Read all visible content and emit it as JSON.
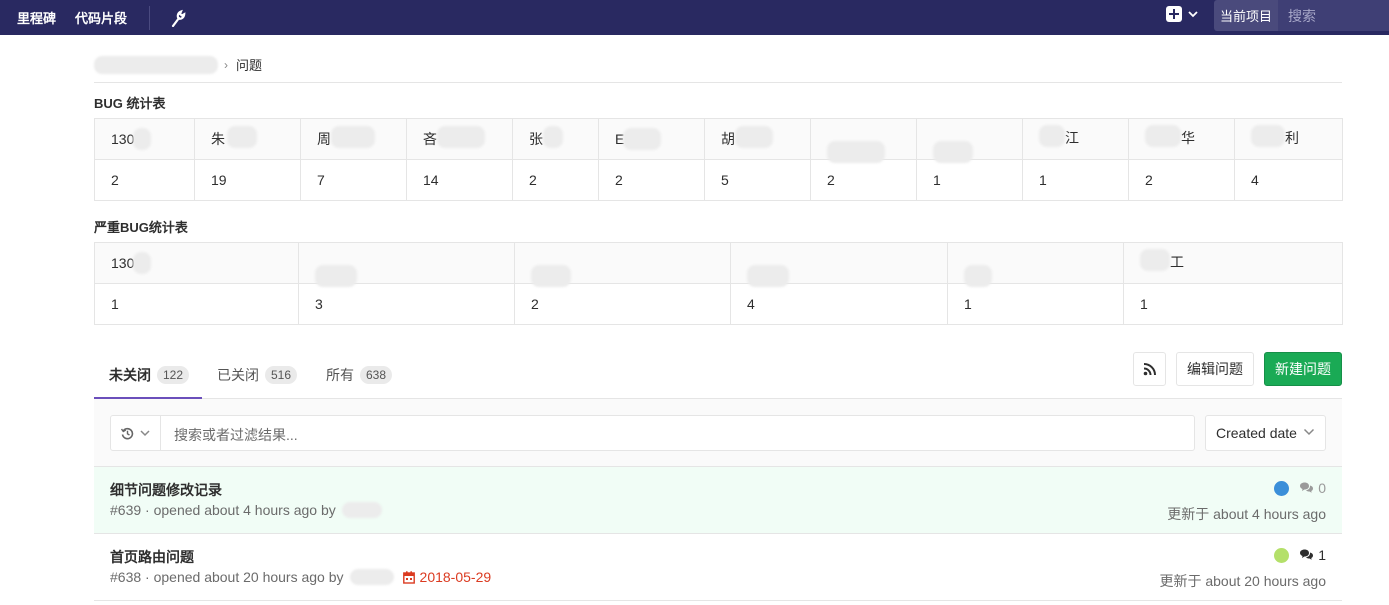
{
  "nav": {
    "links": [
      "里程碑",
      "代码片段"
    ],
    "scope_label": "当前项目",
    "search_placeholder": "搜索",
    "icons": [
      "wrench-icon",
      "plus-square-icon",
      "chevron-down-icon"
    ]
  },
  "breadcrumb": {
    "current": "问题"
  },
  "bug_table": {
    "title": "BUG 统计表",
    "names": [
      "130",
      "朱",
      "周",
      "吝",
      "张",
      "E",
      "胡",
      "",
      "",
      "江",
      "华",
      "利"
    ],
    "counts": [
      "2",
      "19",
      "7",
      "14",
      "2",
      "2",
      "5",
      "2",
      "1",
      "1",
      "2",
      "4"
    ]
  },
  "severe_table": {
    "title": "严重BUG统计表",
    "names": [
      "130",
      "",
      "",
      "",
      "",
      "工"
    ],
    "counts": [
      "1",
      "3",
      "2",
      "4",
      "1",
      "1"
    ]
  },
  "tabs": [
    {
      "label": "未关闭",
      "count": "122"
    },
    {
      "label": "已关闭",
      "count": "516"
    },
    {
      "label": "所有",
      "count": "638"
    }
  ],
  "actions": {
    "edit": "编辑问题",
    "new": "新建问题"
  },
  "filter": {
    "placeholder": "搜索或者过滤结果...",
    "sort": "Created date"
  },
  "issues": [
    {
      "title": "细节问题修改记录",
      "meta": "#639 · opened about 4 hours ago by",
      "comments": "0",
      "updated": "更新于 about 4 hours ago",
      "avatar_color": "#3b8fd9"
    },
    {
      "title": "首页路由问题",
      "meta": "#638 · opened about 20 hours ago by",
      "due": "2018-05-29",
      "comments": "1",
      "updated": "更新于 about 20 hours ago",
      "avatar_color": "#b4e06a"
    }
  ]
}
